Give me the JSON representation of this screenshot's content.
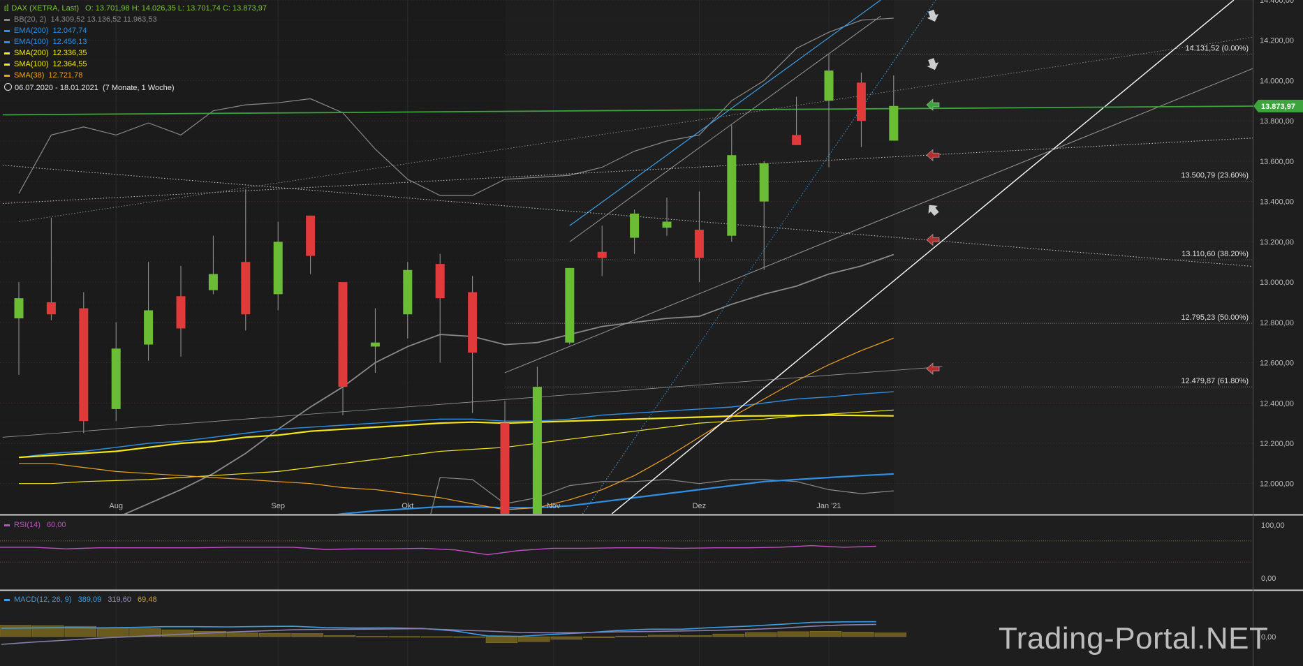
{
  "instrument": {
    "name": "DAX (XETRA, Last)",
    "ohlc_text": "O: 13.701,98  H: 14.026,35  L: 13.701,74  C: 13.873,97",
    "color": "#7ec53b"
  },
  "legend": [
    {
      "name": "BB(20, 2)",
      "values": "14.309,52  13.136,52  11.963,53",
      "color": "#888888"
    },
    {
      "name": "EMA(200)",
      "values": "12.047,74",
      "color": "#2f8fe6"
    },
    {
      "name": "EMA(100)",
      "values": "12.456,13",
      "color": "#2f8fe6"
    },
    {
      "name": "SMA(200)",
      "values": "12.336,35",
      "color": "#f5e81a"
    },
    {
      "name": "SMA(100)",
      "values": "12.364,55",
      "color": "#f5e81a"
    },
    {
      "name": "SMA(38)",
      "values": "12.721,78",
      "color": "#f0a321"
    }
  ],
  "period": {
    "range": "06.07.2020 - 18.01.2021",
    "duration": "(7 Monate, 1 Woche)"
  },
  "last_price": {
    "label": "13.873,97",
    "value": 13873.97,
    "color": "#3da43d"
  },
  "watermark": "Trading-Portal.NET",
  "colors": {
    "bull": "#6cbd36",
    "bear": "#e03a3a",
    "background": "#1e1e1e",
    "grid": "#3a2a2a"
  },
  "chart_data": {
    "type": "candlestick",
    "y_axis": {
      "min": 11850,
      "max": 14400,
      "ticks": [
        "14.400,00",
        "14.200,00",
        "14.000,00",
        "13.800,00",
        "13.600,00",
        "13.400,00",
        "13.200,00",
        "13.000,00",
        "12.800,00",
        "12.600,00",
        "12.400,00",
        "12.200,00",
        "12.000,00"
      ],
      "tick_values": [
        14400,
        14200,
        14000,
        13800,
        13600,
        13400,
        13200,
        13000,
        12800,
        12600,
        12400,
        12200,
        12000
      ]
    },
    "x_axis": {
      "labels": [
        "Aug",
        "Sep",
        "Okt",
        "Nov",
        "Dez",
        "Jan '21"
      ],
      "label_index": [
        3,
        8,
        12,
        16.5,
        21,
        25
      ]
    },
    "candles": [
      {
        "o": 12820,
        "h": 13000,
        "l": 12540,
        "c": 12920
      },
      {
        "o": 12900,
        "h": 13320,
        "l": 12810,
        "c": 12840
      },
      {
        "o": 12870,
        "h": 12950,
        "l": 12250,
        "c": 12310
      },
      {
        "o": 12370,
        "h": 12800,
        "l": 12310,
        "c": 12670
      },
      {
        "o": 12690,
        "h": 13100,
        "l": 12610,
        "c": 12860
      },
      {
        "o": 12930,
        "h": 13080,
        "l": 12630,
        "c": 12770
      },
      {
        "o": 12960,
        "h": 13230,
        "l": 12940,
        "c": 13040
      },
      {
        "o": 13100,
        "h": 13460,
        "l": 12760,
        "c": 12840
      },
      {
        "o": 12940,
        "h": 13300,
        "l": 12860,
        "c": 13200
      },
      {
        "o": 13330,
        "h": 13330,
        "l": 13040,
        "c": 13130
      },
      {
        "o": 13000,
        "h": 13000,
        "l": 12340,
        "c": 12480
      },
      {
        "o": 12680,
        "h": 12870,
        "l": 12550,
        "c": 12700
      },
      {
        "o": 12840,
        "h": 13100,
        "l": 12720,
        "c": 13060
      },
      {
        "o": 13090,
        "h": 13140,
        "l": 12600,
        "c": 12920
      },
      {
        "o": 12950,
        "h": 13030,
        "l": 12350,
        "c": 12650
      },
      {
        "o": 12300,
        "h": 12410,
        "l": 11580,
        "c": 11600
      },
      {
        "o": 11600,
        "h": 12580,
        "l": 11560,
        "c": 12480
      },
      {
        "o": 12700,
        "h": 13070,
        "l": 12690,
        "c": 13070
      },
      {
        "o": 13150,
        "h": 13280,
        "l": 13030,
        "c": 13120
      },
      {
        "o": 13220,
        "h": 13360,
        "l": 13140,
        "c": 13340
      },
      {
        "o": 13270,
        "h": 13420,
        "l": 13230,
        "c": 13300
      },
      {
        "o": 13260,
        "h": 13450,
        "l": 13000,
        "c": 13120
      },
      {
        "o": 13230,
        "h": 13780,
        "l": 13200,
        "c": 13630
      },
      {
        "o": 13400,
        "h": 13600,
        "l": 13060,
        "c": 13590
      },
      {
        "o": 13730,
        "h": 13920,
        "l": 13680,
        "c": 13680
      },
      {
        "o": 13900,
        "h": 14130,
        "l": 13570,
        "c": 14050
      },
      {
        "o": 13990,
        "h": 14040,
        "l": 13670,
        "c": 13800
      },
      {
        "o": 13702,
        "h": 14026,
        "l": 13702,
        "c": 13874
      }
    ],
    "fib_levels": [
      {
        "value": 14131.52,
        "label": "14.131,52 (0.00%)"
      },
      {
        "value": 13500.79,
        "label": "13.500,79 (23.60%)"
      },
      {
        "value": 13110.6,
        "label": "13.110,60 (38.20%)"
      },
      {
        "value": 12795.23,
        "label": "12.795,23 (50.00%)"
      },
      {
        "value": 12479.87,
        "label": "12.479,87 (61.80%)"
      }
    ],
    "series": [
      {
        "key": "bb_upper",
        "color": "#8a8a8a",
        "width": 1.2,
        "values": [
          13440,
          13730,
          13770,
          13730,
          13790,
          13730,
          13850,
          13880,
          13890,
          13910,
          13840,
          13660,
          13510,
          13430,
          13430,
          13510,
          13520,
          13530,
          13570,
          13650,
          13700,
          13730,
          13900,
          14000,
          14160,
          14240,
          14300,
          14310
        ]
      },
      {
        "key": "bb_middle",
        "color": "#8a8a8a",
        "width": 1.8,
        "values": [
          11650,
          11700,
          11760,
          11830,
          11900,
          11970,
          12050,
          12150,
          12270,
          12380,
          12480,
          12600,
          12680,
          12740,
          12730,
          12690,
          12700,
          12740,
          12780,
          12800,
          12820,
          12830,
          12890,
          12940,
          12980,
          13040,
          13080,
          13137
        ]
      },
      {
        "key": "bb_lower",
        "color": "#8a8a8a",
        "width": 1.2,
        "values": [
          11400,
          11400,
          11400,
          11400,
          11400,
          11400,
          11400,
          11400,
          11400,
          11400,
          11400,
          11400,
          11400,
          12030,
          12020,
          11900,
          11930,
          11990,
          12010,
          12010,
          12020,
          12000,
          12020,
          12020,
          12010,
          11970,
          11950,
          11964
        ]
      },
      {
        "key": "ema200",
        "color": "#2f8fe6",
        "width": 2.2,
        "values": [
          11600,
          11620,
          11640,
          11660,
          11690,
          11720,
          11750,
          11780,
          11810,
          11830,
          11850,
          11865,
          11875,
          11885,
          11885,
          11880,
          11880,
          11890,
          11910,
          11930,
          11950,
          11970,
          11990,
          12010,
          12020,
          12030,
          12040,
          12048
        ]
      },
      {
        "key": "ema100",
        "color": "#2f8fe6",
        "width": 1.4,
        "values": [
          12130,
          12150,
          12160,
          12180,
          12200,
          12210,
          12230,
          12250,
          12270,
          12280,
          12290,
          12300,
          12310,
          12320,
          12320,
          12310,
          12310,
          12320,
          12340,
          12350,
          12360,
          12370,
          12380,
          12400,
          12420,
          12430,
          12445,
          12456
        ]
      },
      {
        "key": "sma200",
        "color": "#f5e81a",
        "width": 2.2,
        "values": [
          12130,
          12140,
          12150,
          12160,
          12180,
          12200,
          12210,
          12230,
          12240,
          12260,
          12270,
          12280,
          12290,
          12300,
          12305,
          12300,
          12305,
          12310,
          12315,
          12320,
          12325,
          12330,
          12335,
          12336,
          12338,
          12340,
          12338,
          12336
        ]
      },
      {
        "key": "sma100",
        "color": "#f5e81a",
        "width": 1.2,
        "values": [
          12000,
          12000,
          12010,
          12015,
          12020,
          12030,
          12040,
          12050,
          12060,
          12080,
          12100,
          12120,
          12140,
          12160,
          12170,
          12180,
          12200,
          12220,
          12240,
          12260,
          12280,
          12300,
          12310,
          12320,
          12335,
          12345,
          12355,
          12365
        ]
      },
      {
        "key": "sma38",
        "color": "#f0a321",
        "width": 1.2,
        "values": [
          12100,
          12100,
          12080,
          12060,
          12050,
          12040,
          12030,
          12020,
          12010,
          12000,
          11980,
          11970,
          11950,
          11930,
          11900,
          11870,
          11880,
          11920,
          11970,
          12040,
          12130,
          12230,
          12330,
          12420,
          12510,
          12590,
          12660,
          12722
        ]
      }
    ],
    "trendlines": [
      {
        "key": "resistance-upper",
        "color": "#3aa0e8",
        "style": "solid",
        "width": 1.2,
        "from": [
          17,
          13280
        ],
        "to": [
          26.6,
          14400
        ]
      },
      {
        "key": "channel-gray-upper",
        "color": "#999999",
        "style": "solid",
        "width": 1.0,
        "from": [
          17,
          13200
        ],
        "to": [
          26.6,
          14320
        ]
      },
      {
        "key": "support-white",
        "color": "#ffffff",
        "style": "solid",
        "width": 1.4,
        "from": [
          18.3,
          11850
        ],
        "to": [
          37.5,
          14400
        ]
      },
      {
        "key": "channel-gray-lower",
        "color": "#999999",
        "style": "solid",
        "width": 1.0,
        "from": [
          15,
          12550
        ],
        "to": [
          38.7,
          14100
        ]
      },
      {
        "key": "long-gray",
        "color": "#999999",
        "style": "solid",
        "width": 0.8,
        "from": [
          -0.5,
          12230
        ],
        "to": [
          28.5,
          12580
        ]
      },
      {
        "key": "green-horizontal",
        "color": "#3da43d",
        "style": "solid",
        "width": 1.8,
        "from": [
          -0.5,
          13830
        ],
        "to": [
          38.7,
          13873.97
        ]
      },
      {
        "key": "dotted-white-falling",
        "color": "#cccccc",
        "style": "dotted",
        "width": 1.0,
        "from": [
          -0.5,
          13580
        ],
        "to": [
          38.7,
          13070
        ]
      },
      {
        "key": "dotted-white-rising",
        "color": "#cccccc",
        "style": "dotted",
        "width": 1.0,
        "from": [
          -0.5,
          13390
        ],
        "to": [
          38.7,
          13720
        ]
      },
      {
        "key": "dotted-gray-top",
        "color": "#888888",
        "style": "dotted",
        "width": 1.0,
        "from": [
          0,
          13300
        ],
        "to": [
          38.7,
          14230
        ]
      },
      {
        "key": "dotted-blue-steep",
        "color": "#3aa0e8",
        "style": "dotted",
        "width": 1.0,
        "from": [
          17.4,
          11850
        ],
        "to": [
          28.3,
          14400
        ]
      }
    ],
    "signal_arrows": [
      {
        "y": 14320,
        "kind": "down",
        "color": "#cccccc"
      },
      {
        "y": 14080,
        "kind": "down",
        "color": "#cccccc"
      },
      {
        "y": 13880,
        "kind": "left",
        "color": "#3da43d"
      },
      {
        "y": 13630,
        "kind": "left",
        "color": "#b03030"
      },
      {
        "y": 13360,
        "kind": "up",
        "color": "#cccccc"
      },
      {
        "y": 13210,
        "kind": "left",
        "color": "#b03030"
      },
      {
        "y": 12570,
        "kind": "left",
        "color": "#b03030"
      }
    ]
  },
  "rsi": {
    "label": "RSI(14)",
    "value_text": "60,00",
    "color": "#c050c0",
    "axis_labels": [
      "100,00",
      "0,00"
    ],
    "values": [
      58,
      58,
      55,
      57,
      57,
      57,
      57,
      58,
      58,
      58,
      54,
      55,
      55,
      56,
      53,
      44,
      52,
      56,
      56,
      57,
      57,
      56,
      57,
      57,
      58,
      61,
      58,
      60
    ]
  },
  "macd": {
    "label": "MACD(12, 26, 9)",
    "macd_text": "389,09",
    "signal_text": "319,60",
    "hist_text": "69,48",
    "axis_label": "0,00",
    "macd_color": "#3aa0e8",
    "signal_color": "#8a7fb0",
    "hist_color": "#6b5a1e",
    "macd_values": [
      220,
      230,
      235,
      230,
      240,
      260,
      260,
      255,
      265,
      270,
      235,
      225,
      230,
      215,
      150,
      20,
      10,
      60,
      100,
      160,
      195,
      195,
      240,
      270,
      320,
      370,
      385,
      389
    ],
    "signal_values": [
      -200,
      -140,
      -90,
      -40,
      0,
      40,
      80,
      120,
      150,
      180,
      190,
      195,
      200,
      210,
      175,
      145,
      110,
      100,
      110,
      125,
      135,
      150,
      165,
      185,
      220,
      270,
      305,
      320
    ],
    "hist_values": [
      300,
      290,
      270,
      240,
      210,
      180,
      140,
      100,
      90,
      85,
      30,
      10,
      5,
      2,
      -20,
      -160,
      -130,
      -70,
      -30,
      15,
      40,
      30,
      70,
      110,
      130,
      140,
      120,
      100
    ]
  }
}
